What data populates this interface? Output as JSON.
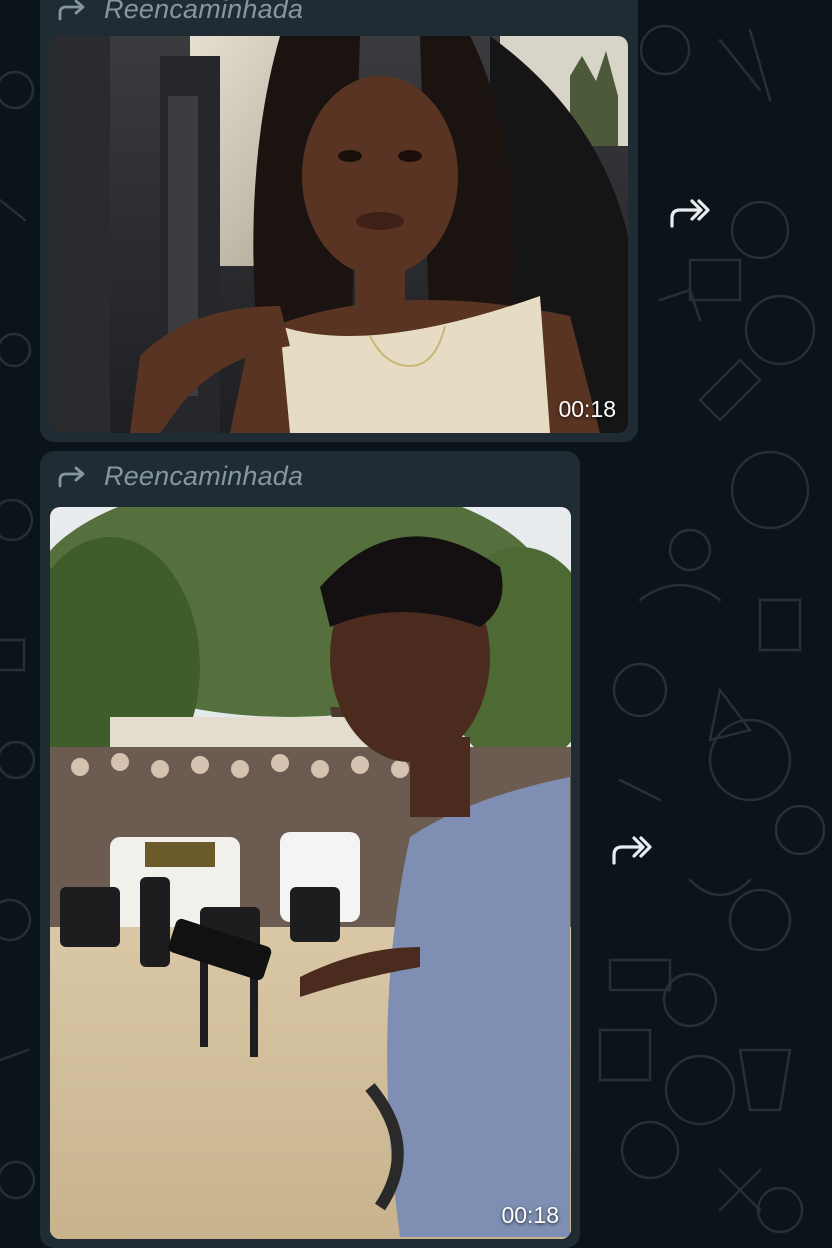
{
  "colors": {
    "chat_background": "#0b141a",
    "bubble_background": "#1f2c34",
    "forwarded_label": "#8696a0",
    "duration_text": "#ffffff"
  },
  "messages": [
    {
      "forwarded_icon": "forwarded-arrow-icon",
      "forwarded_label": "Reencaminhada",
      "media_type": "video",
      "duration": "00:18",
      "share_icon": "forward-share-icon"
    },
    {
      "forwarded_icon": "forwarded-arrow-icon",
      "forwarded_label": "Reencaminhada",
      "media_type": "video",
      "duration": "00:18",
      "share_icon": "forward-share-icon"
    }
  ]
}
